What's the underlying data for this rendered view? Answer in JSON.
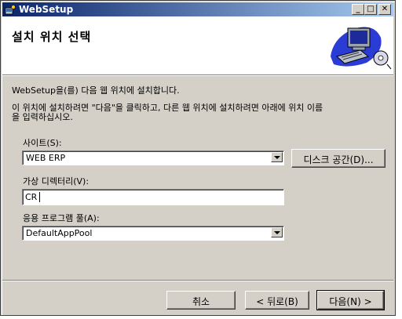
{
  "window": {
    "title": "WebSetup",
    "buttons": {
      "minimize": "_",
      "maximize": "□",
      "close": "✕"
    },
    "icons": [
      "setup-app-icon",
      "computer-install-graphic"
    ]
  },
  "header": {
    "title": "설치 위치 선택"
  },
  "body": {
    "intro": "WebSetup을(를) 다음 웹 위치에 설치합니다.",
    "instructions_line1": "이 위치에 설치하려면 \"다음\"을 클릭하고, 다른 웹 위치에 설치하려면 아래에 위치 이름",
    "instructions_line2": "을 입력하십시오."
  },
  "form": {
    "site": {
      "label": "사이트(S):",
      "value": "WEB ERP"
    },
    "disk_space_button": "디스크 공간(D)...",
    "virtual_dir": {
      "label": "가상 디렉터리(V):",
      "value": "CR"
    },
    "app_pool": {
      "label": "응용 프로그램 풀(A):",
      "value": "DefaultAppPool"
    }
  },
  "footer": {
    "cancel": "취소",
    "back": "< 뒤로(B)",
    "next": "다음(N) >"
  }
}
